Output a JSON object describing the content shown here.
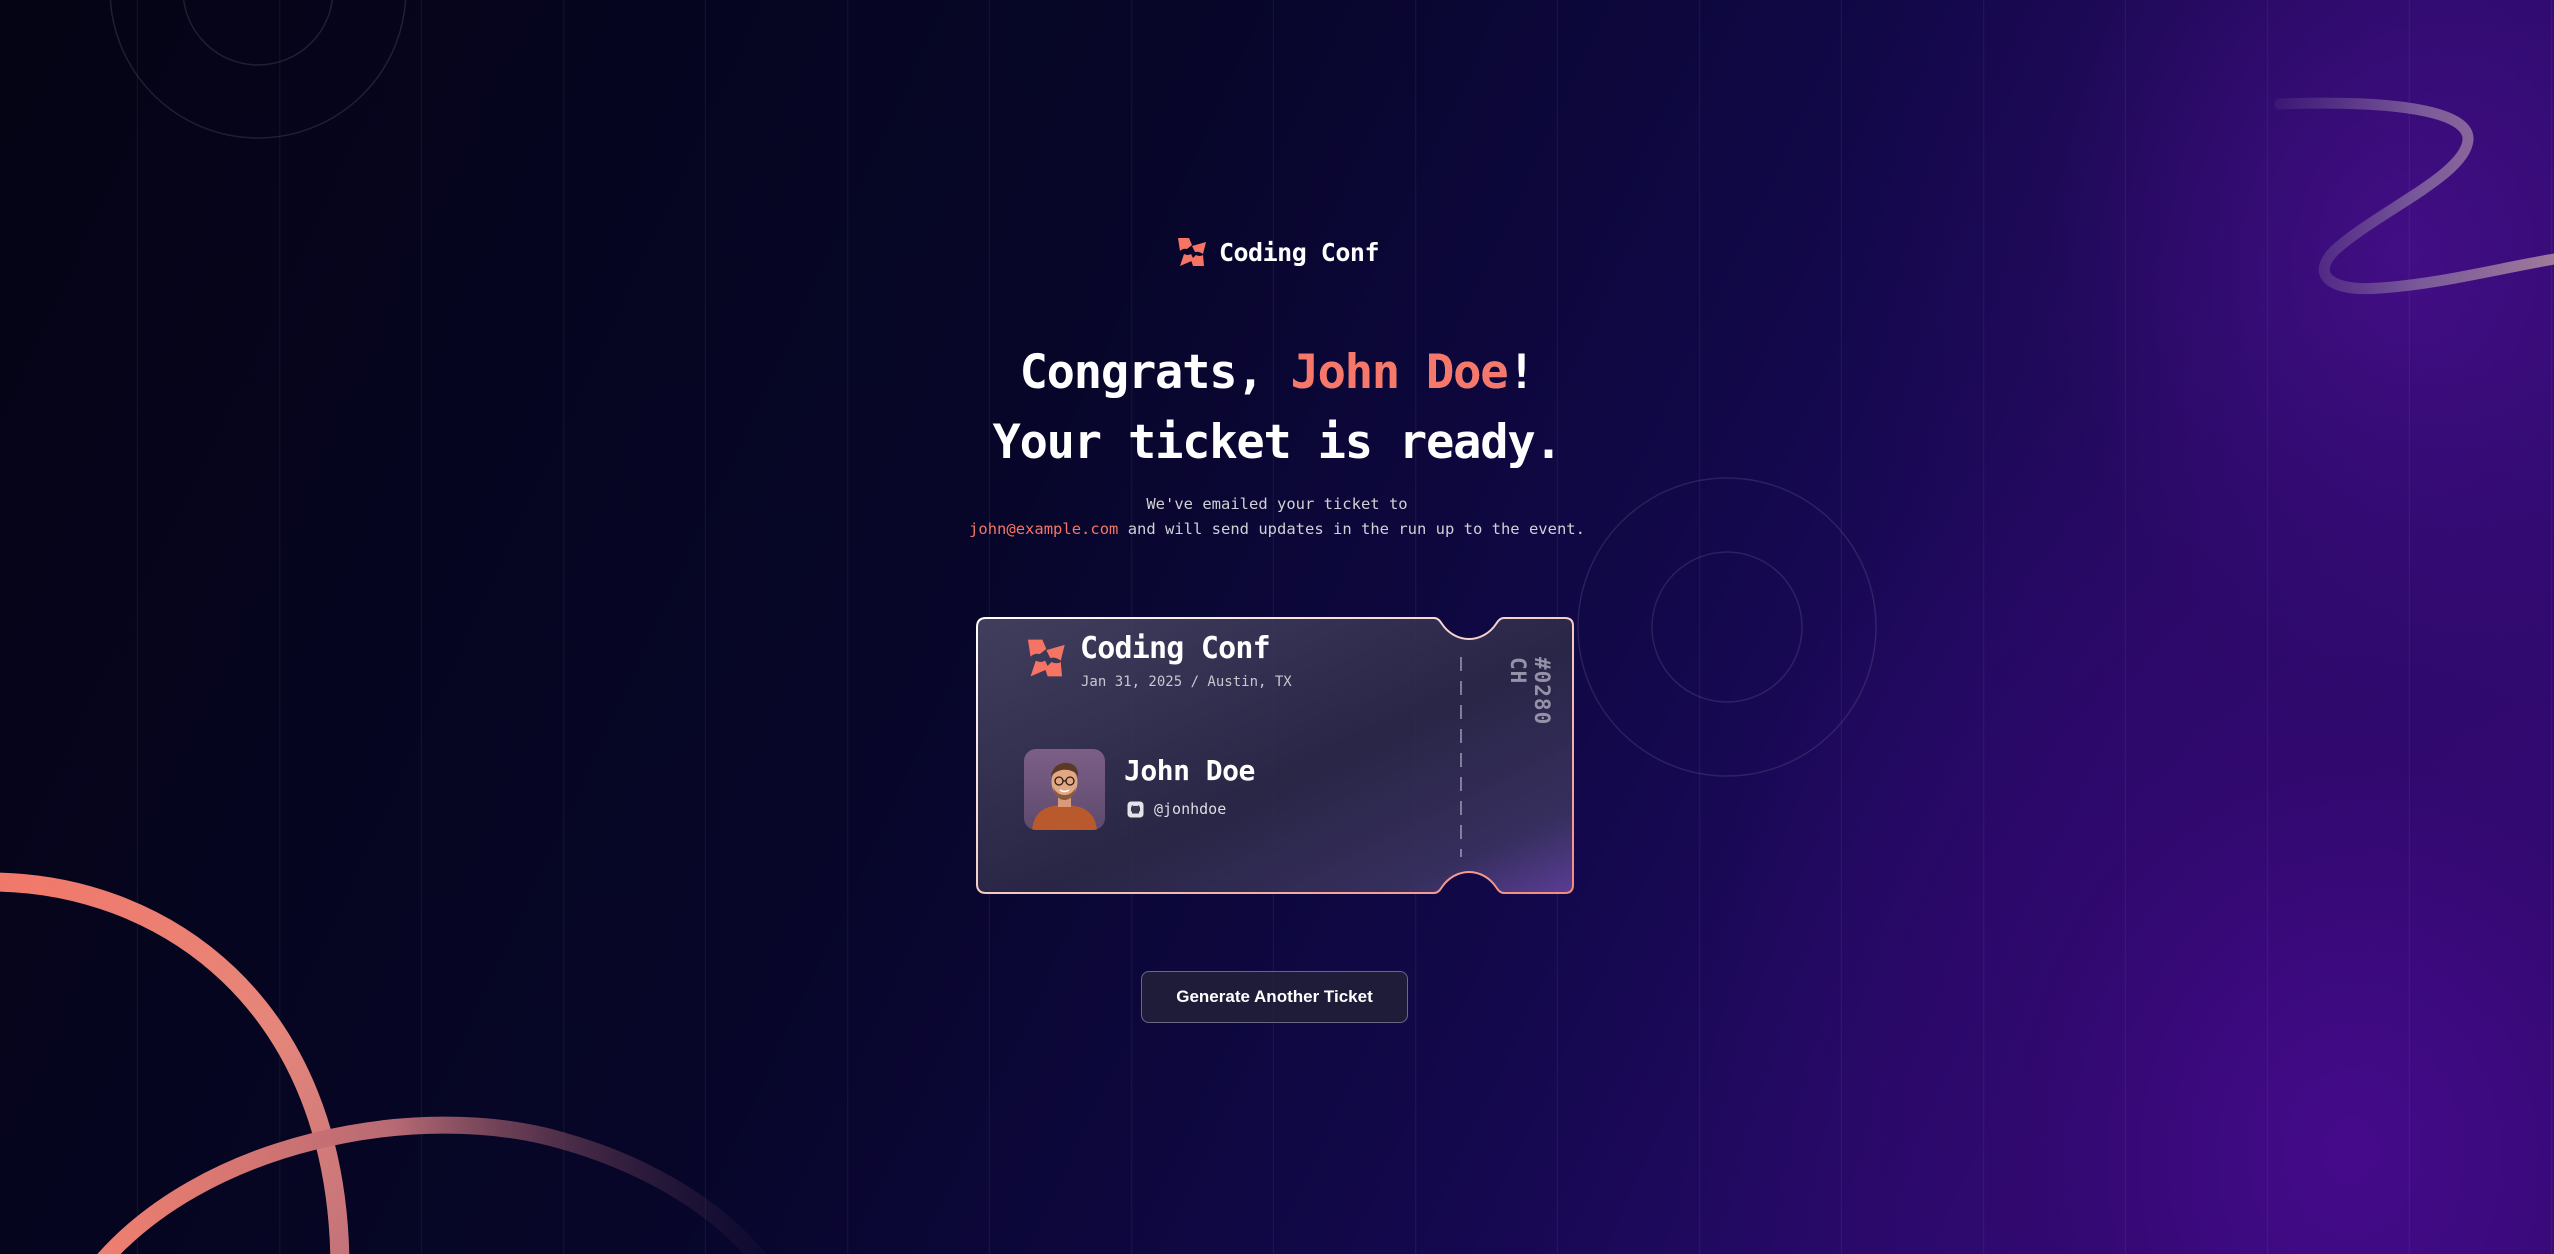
{
  "brand": {
    "name": "Coding Conf",
    "accent_color": "#f57463",
    "logo_icon": "coding-conf-logo-icon"
  },
  "headline": {
    "prefix": "Congrats, ",
    "attendee_name": "John Doe",
    "suffix": "!",
    "line2": "Your ticket is ready."
  },
  "confirmation": {
    "line1": "We've emailed your ticket to",
    "email": "john@example.com",
    "line2_rest": " and will send updates in the run up to the event."
  },
  "ticket": {
    "event_name": "Coding Conf",
    "date_location": "Jan 31, 2025 / Austin, TX",
    "attendee_name": "John Doe",
    "github_icon": "github-icon",
    "github_handle": "@jonhdoe",
    "ticket_number": "#0280\nCH",
    "avatar": "attendee-avatar-photo"
  },
  "actions": {
    "generate_another_label": "Generate Another Ticket"
  },
  "colors": {
    "background": "#06051a",
    "accent": "#f57463",
    "purple_glow": "#3a0c80",
    "button_border": "#6a6785"
  }
}
